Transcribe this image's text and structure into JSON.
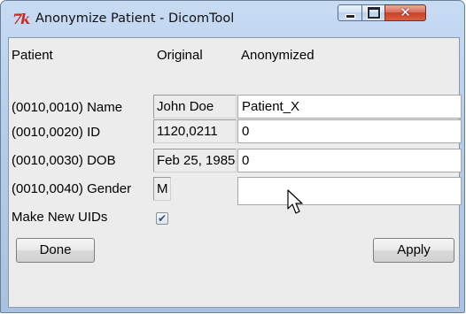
{
  "window": {
    "title": "Anonymize Patient - DicomTool",
    "app_icon": "tk-feather-icon",
    "controls": {
      "minimize": "minimize-icon",
      "maximize": "maximize-icon",
      "close": "close-icon"
    }
  },
  "headers": {
    "patient": "Patient",
    "original": "Original",
    "anonymized": "Anonymized"
  },
  "rows": [
    {
      "label": "(0010,0010) Name",
      "original": "John Doe",
      "anonymized": "Patient_X"
    },
    {
      "label": "(0010,0020) ID",
      "original": "1120,0211",
      "anonymized": "0"
    },
    {
      "label": "(0010,0030) DOB",
      "original": "Feb 25, 1985",
      "anonymized": "0"
    },
    {
      "label": "(0010,0040) Gender",
      "original": "M",
      "anonymized": ""
    }
  ],
  "make_new_uids": {
    "label": "Make New UIDs",
    "checked": true
  },
  "buttons": {
    "done": "Done",
    "apply": "Apply"
  },
  "colors": {
    "accent": "#cc2a1f",
    "close_button": "#c8412a",
    "frame": "#b6cde9"
  }
}
